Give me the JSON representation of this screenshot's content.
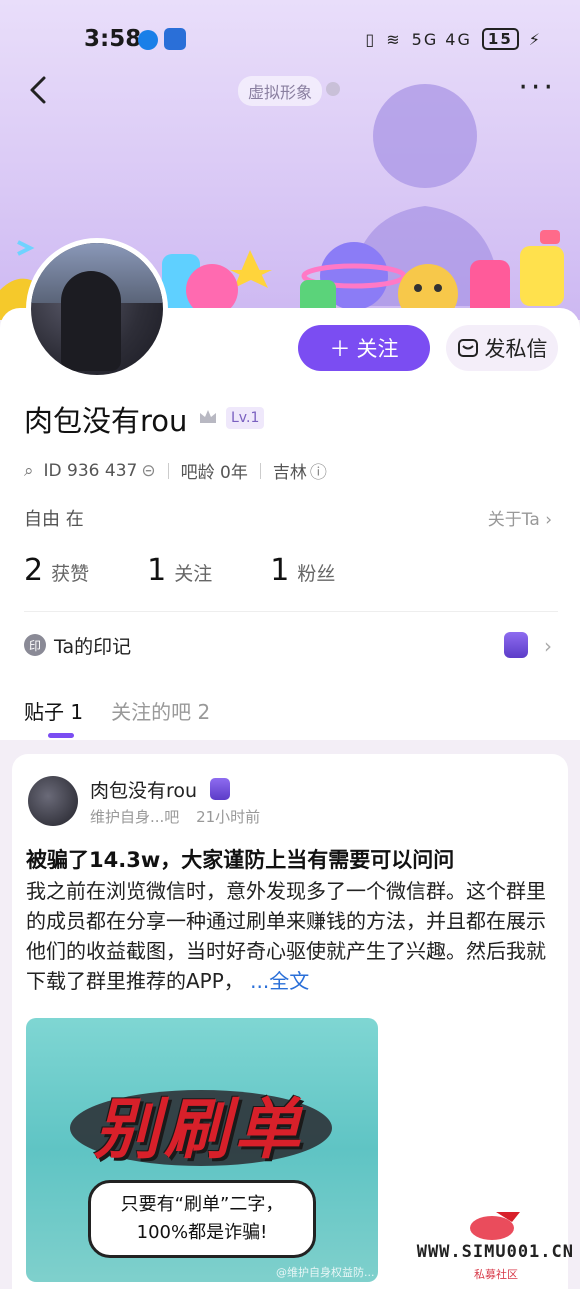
{
  "status_bar": {
    "time": "3:58",
    "network": "5G 4G",
    "battery": "15"
  },
  "header": {
    "virtual_tag": "虚拟形象"
  },
  "profile": {
    "username": "肉包没有rou",
    "level": "Lv.1",
    "id_text": "ID 936  437",
    "bar_age": "吧龄 0年",
    "location": "吉林",
    "bio": "自由  在",
    "about_link": "关于Ta",
    "follow_button": "关注",
    "message_button": "发私信",
    "stats": [
      {
        "num": "2",
        "label": "获赞"
      },
      {
        "num": "1",
        "label": "关注"
      },
      {
        "num": "1",
        "label": "粉丝"
      }
    ],
    "mark_icon": "印",
    "mark_title": "Ta的印记"
  },
  "tabs": [
    {
      "label": "贴子 1"
    },
    {
      "label": "关注的吧 2"
    }
  ],
  "post": {
    "author": "肉包没有rou",
    "forum": "维护自身...吧",
    "time_ago": "21小时前",
    "title": "被骗了14.3w，大家谨防上当有需要可以问问",
    "body": "我之前在浏览微信时，意外发现多了一个微信群。这个群里的成员都在分享一种通过刷单来赚钱的方法，并且都在展示他们的收益截图，当时好奇心驱使就产生了兴趣。然后我就下载了群里推荐的APP， ",
    "more_link": "...全文",
    "image_headline": "别刷单",
    "image_bubble_line1": "只要有“刷单”二字，",
    "image_bubble_line2": "100%都是诈骗!",
    "image_caption": "@维护自身权益防..."
  },
  "watermark": {
    "site": "WWW.SIMU001.CN",
    "sub": "私募社区"
  },
  "colors": {
    "accent": "#7b4df2",
    "link": "#2a6fd8"
  }
}
